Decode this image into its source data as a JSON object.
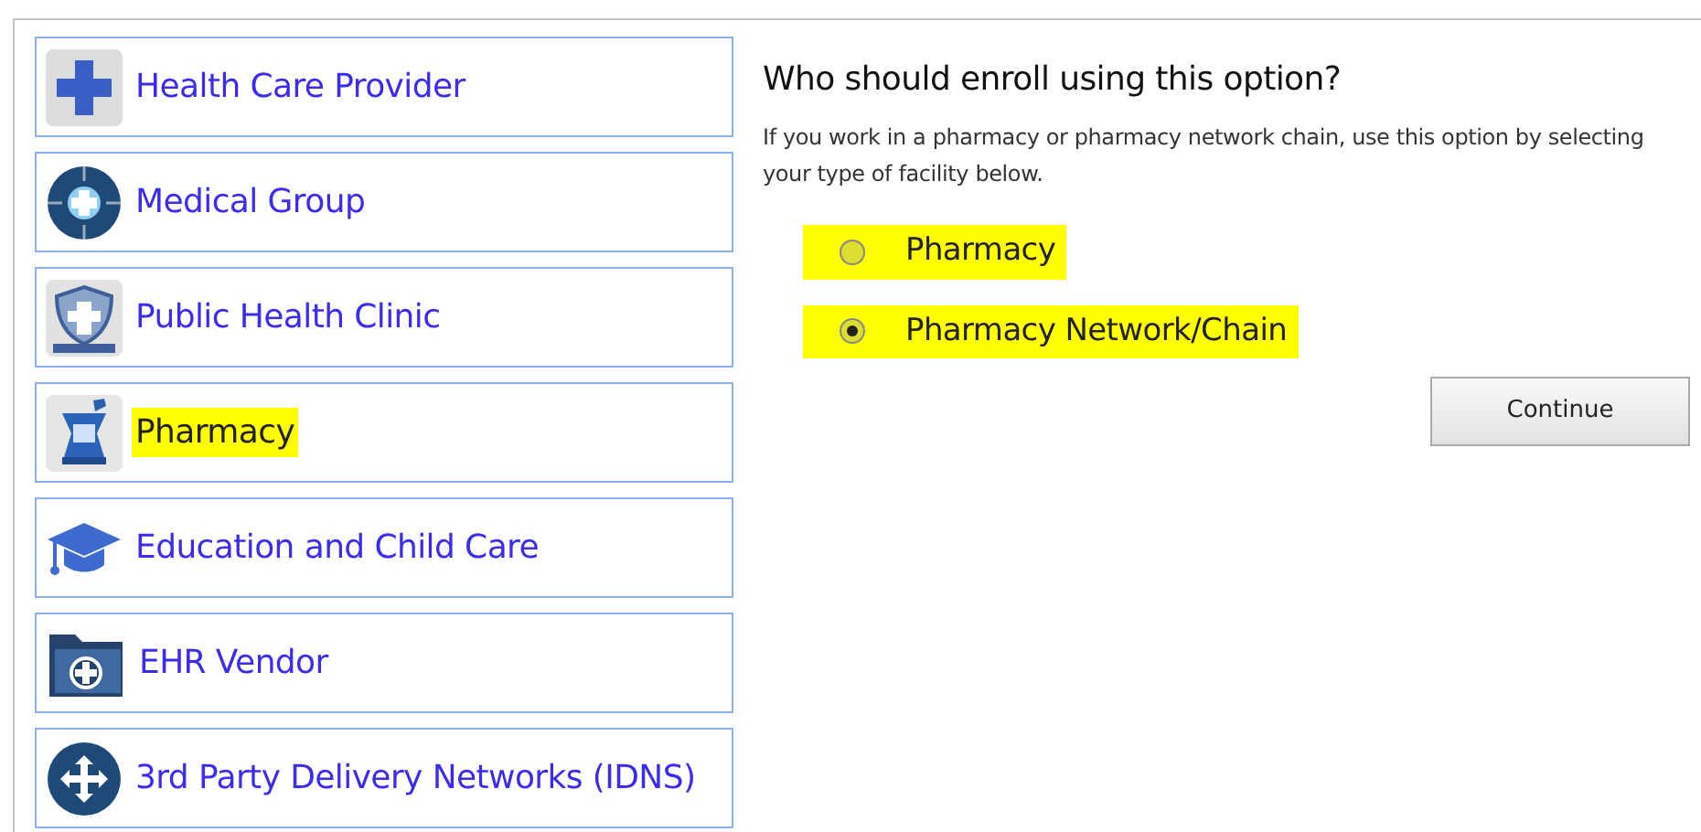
{
  "options": [
    {
      "label": "Health Care Provider",
      "highlighted": false
    },
    {
      "label": "Medical Group",
      "highlighted": false
    },
    {
      "label": "Public Health Clinic",
      "highlighted": false
    },
    {
      "label": "Pharmacy",
      "highlighted": true
    },
    {
      "label": "Education and Child Care",
      "highlighted": false
    },
    {
      "label": "EHR Vendor",
      "highlighted": false
    },
    {
      "label": "3rd Party Delivery Networks (IDNS)",
      "highlighted": false
    }
  ],
  "detail": {
    "heading": "Who should enroll using this option?",
    "description": "If you work in a pharmacy or pharmacy network chain, use this option by selecting your type of facility below.",
    "choices": [
      {
        "label": "Pharmacy",
        "selected": false,
        "highlighted": true
      },
      {
        "label": "Pharmacy Network/Chain",
        "selected": true,
        "highlighted": true
      }
    ],
    "button": "Continue"
  }
}
